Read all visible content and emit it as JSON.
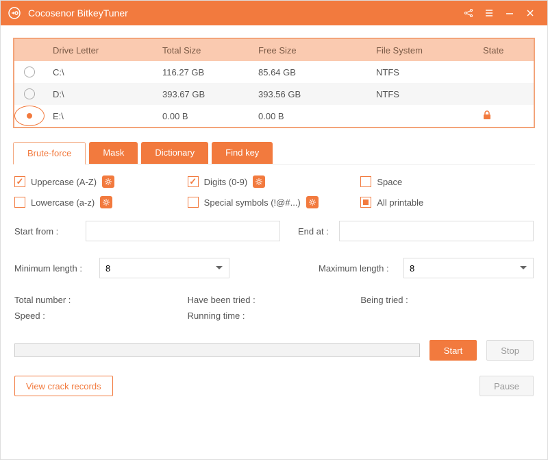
{
  "app": {
    "title": "Cocosenor BitkeyTuner"
  },
  "table": {
    "headers": {
      "drive": "Drive Letter",
      "total": "Total Size",
      "free": "Free Size",
      "fs": "File System",
      "state": "State"
    },
    "rows": [
      {
        "letter": "C:\\",
        "total": "116.27 GB",
        "free": "85.64 GB",
        "fs": "NTFS",
        "selected": false,
        "locked": false
      },
      {
        "letter": "D:\\",
        "total": "393.67 GB",
        "free": "393.56 GB",
        "fs": "NTFS",
        "selected": false,
        "locked": false
      },
      {
        "letter": "E:\\",
        "total": "0.00 B",
        "free": "0.00 B",
        "fs": "",
        "selected": true,
        "locked": true
      }
    ]
  },
  "tabs": {
    "t0": "Brute-force",
    "t1": "Mask",
    "t2": "Dictionary",
    "t3": "Find key"
  },
  "opts": {
    "upper": "Uppercase (A-Z)",
    "digits": "Digits (0-9)",
    "space": "Space",
    "lower": "Lowercase (a-z)",
    "special": "Special symbols (!@#...)",
    "all": "All printable"
  },
  "fields": {
    "start": "Start from :",
    "end": "End at :",
    "min": "Minimum length :",
    "max": "Maximum length :",
    "min_val": "8",
    "max_val": "8"
  },
  "status": {
    "total": "Total number :",
    "tried": "Have been tried :",
    "being": "Being tried :",
    "speed": "Speed :",
    "runtime": "Running time :"
  },
  "buttons": {
    "start": "Start",
    "stop": "Stop",
    "view": "View crack records",
    "pause": "Pause"
  }
}
